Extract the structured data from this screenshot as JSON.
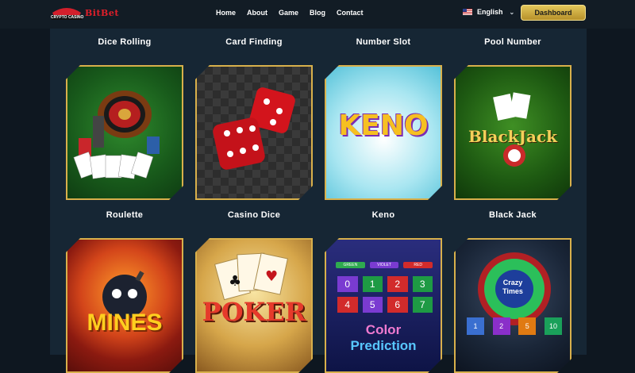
{
  "nav": {
    "brand": "BitBet",
    "logo_sub": "CRYPTO CASINO",
    "links": [
      "Home",
      "About",
      "Game",
      "Blog",
      "Contact"
    ],
    "language": "English",
    "dashboard_label": "Dashboard"
  },
  "games": {
    "row1_titles": [
      "Dice Rolling",
      "Card Finding",
      "Number Slot",
      "Pool Number"
    ],
    "row2_titles": [
      "Roulette",
      "Casino Dice",
      "Keno",
      "Black Jack"
    ],
    "card_texts": {
      "keno": "KENO",
      "blackjack_1": "Black",
      "blackjack_2": "Jack",
      "mines": "MINES",
      "poker": "POKER",
      "color_1": "Color",
      "color_2": "Prediction",
      "color_tabs": [
        "GREEN",
        "VIOLET",
        "RED"
      ],
      "color_nums": [
        "0",
        "1",
        "2",
        "3",
        "4",
        "5",
        "6",
        "7"
      ],
      "crazy_1": "Crazy",
      "crazy_2": "Times",
      "crazy_tiles": [
        "1",
        "2",
        "5",
        "10"
      ]
    }
  }
}
